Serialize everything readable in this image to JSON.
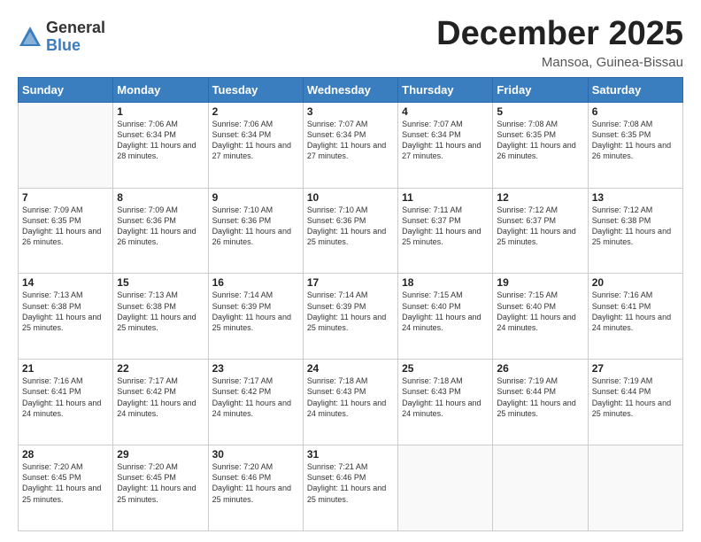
{
  "logo": {
    "general": "General",
    "blue": "Blue"
  },
  "title": "December 2025",
  "subtitle": "Mansoa, Guinea-Bissau",
  "days_of_week": [
    "Sunday",
    "Monday",
    "Tuesday",
    "Wednesday",
    "Thursday",
    "Friday",
    "Saturday"
  ],
  "weeks": [
    [
      {
        "day": "",
        "sunrise": "",
        "sunset": "",
        "daylight": ""
      },
      {
        "day": "1",
        "sunrise": "Sunrise: 7:06 AM",
        "sunset": "Sunset: 6:34 PM",
        "daylight": "Daylight: 11 hours and 28 minutes."
      },
      {
        "day": "2",
        "sunrise": "Sunrise: 7:06 AM",
        "sunset": "Sunset: 6:34 PM",
        "daylight": "Daylight: 11 hours and 27 minutes."
      },
      {
        "day": "3",
        "sunrise": "Sunrise: 7:07 AM",
        "sunset": "Sunset: 6:34 PM",
        "daylight": "Daylight: 11 hours and 27 minutes."
      },
      {
        "day": "4",
        "sunrise": "Sunrise: 7:07 AM",
        "sunset": "Sunset: 6:34 PM",
        "daylight": "Daylight: 11 hours and 27 minutes."
      },
      {
        "day": "5",
        "sunrise": "Sunrise: 7:08 AM",
        "sunset": "Sunset: 6:35 PM",
        "daylight": "Daylight: 11 hours and 26 minutes."
      },
      {
        "day": "6",
        "sunrise": "Sunrise: 7:08 AM",
        "sunset": "Sunset: 6:35 PM",
        "daylight": "Daylight: 11 hours and 26 minutes."
      }
    ],
    [
      {
        "day": "7",
        "sunrise": "Sunrise: 7:09 AM",
        "sunset": "Sunset: 6:35 PM",
        "daylight": "Daylight: 11 hours and 26 minutes."
      },
      {
        "day": "8",
        "sunrise": "Sunrise: 7:09 AM",
        "sunset": "Sunset: 6:36 PM",
        "daylight": "Daylight: 11 hours and 26 minutes."
      },
      {
        "day": "9",
        "sunrise": "Sunrise: 7:10 AM",
        "sunset": "Sunset: 6:36 PM",
        "daylight": "Daylight: 11 hours and 26 minutes."
      },
      {
        "day": "10",
        "sunrise": "Sunrise: 7:10 AM",
        "sunset": "Sunset: 6:36 PM",
        "daylight": "Daylight: 11 hours and 25 minutes."
      },
      {
        "day": "11",
        "sunrise": "Sunrise: 7:11 AM",
        "sunset": "Sunset: 6:37 PM",
        "daylight": "Daylight: 11 hours and 25 minutes."
      },
      {
        "day": "12",
        "sunrise": "Sunrise: 7:12 AM",
        "sunset": "Sunset: 6:37 PM",
        "daylight": "Daylight: 11 hours and 25 minutes."
      },
      {
        "day": "13",
        "sunrise": "Sunrise: 7:12 AM",
        "sunset": "Sunset: 6:38 PM",
        "daylight": "Daylight: 11 hours and 25 minutes."
      }
    ],
    [
      {
        "day": "14",
        "sunrise": "Sunrise: 7:13 AM",
        "sunset": "Sunset: 6:38 PM",
        "daylight": "Daylight: 11 hours and 25 minutes."
      },
      {
        "day": "15",
        "sunrise": "Sunrise: 7:13 AM",
        "sunset": "Sunset: 6:38 PM",
        "daylight": "Daylight: 11 hours and 25 minutes."
      },
      {
        "day": "16",
        "sunrise": "Sunrise: 7:14 AM",
        "sunset": "Sunset: 6:39 PM",
        "daylight": "Daylight: 11 hours and 25 minutes."
      },
      {
        "day": "17",
        "sunrise": "Sunrise: 7:14 AM",
        "sunset": "Sunset: 6:39 PM",
        "daylight": "Daylight: 11 hours and 25 minutes."
      },
      {
        "day": "18",
        "sunrise": "Sunrise: 7:15 AM",
        "sunset": "Sunset: 6:40 PM",
        "daylight": "Daylight: 11 hours and 24 minutes."
      },
      {
        "day": "19",
        "sunrise": "Sunrise: 7:15 AM",
        "sunset": "Sunset: 6:40 PM",
        "daylight": "Daylight: 11 hours and 24 minutes."
      },
      {
        "day": "20",
        "sunrise": "Sunrise: 7:16 AM",
        "sunset": "Sunset: 6:41 PM",
        "daylight": "Daylight: 11 hours and 24 minutes."
      }
    ],
    [
      {
        "day": "21",
        "sunrise": "Sunrise: 7:16 AM",
        "sunset": "Sunset: 6:41 PM",
        "daylight": "Daylight: 11 hours and 24 minutes."
      },
      {
        "day": "22",
        "sunrise": "Sunrise: 7:17 AM",
        "sunset": "Sunset: 6:42 PM",
        "daylight": "Daylight: 11 hours and 24 minutes."
      },
      {
        "day": "23",
        "sunrise": "Sunrise: 7:17 AM",
        "sunset": "Sunset: 6:42 PM",
        "daylight": "Daylight: 11 hours and 24 minutes."
      },
      {
        "day": "24",
        "sunrise": "Sunrise: 7:18 AM",
        "sunset": "Sunset: 6:43 PM",
        "daylight": "Daylight: 11 hours and 24 minutes."
      },
      {
        "day": "25",
        "sunrise": "Sunrise: 7:18 AM",
        "sunset": "Sunset: 6:43 PM",
        "daylight": "Daylight: 11 hours and 24 minutes."
      },
      {
        "day": "26",
        "sunrise": "Sunrise: 7:19 AM",
        "sunset": "Sunset: 6:44 PM",
        "daylight": "Daylight: 11 hours and 25 minutes."
      },
      {
        "day": "27",
        "sunrise": "Sunrise: 7:19 AM",
        "sunset": "Sunset: 6:44 PM",
        "daylight": "Daylight: 11 hours and 25 minutes."
      }
    ],
    [
      {
        "day": "28",
        "sunrise": "Sunrise: 7:20 AM",
        "sunset": "Sunset: 6:45 PM",
        "daylight": "Daylight: 11 hours and 25 minutes."
      },
      {
        "day": "29",
        "sunrise": "Sunrise: 7:20 AM",
        "sunset": "Sunset: 6:45 PM",
        "daylight": "Daylight: 11 hours and 25 minutes."
      },
      {
        "day": "30",
        "sunrise": "Sunrise: 7:20 AM",
        "sunset": "Sunset: 6:46 PM",
        "daylight": "Daylight: 11 hours and 25 minutes."
      },
      {
        "day": "31",
        "sunrise": "Sunrise: 7:21 AM",
        "sunset": "Sunset: 6:46 PM",
        "daylight": "Daylight: 11 hours and 25 minutes."
      },
      {
        "day": "",
        "sunrise": "",
        "sunset": "",
        "daylight": ""
      },
      {
        "day": "",
        "sunrise": "",
        "sunset": "",
        "daylight": ""
      },
      {
        "day": "",
        "sunrise": "",
        "sunset": "",
        "daylight": ""
      }
    ]
  ]
}
